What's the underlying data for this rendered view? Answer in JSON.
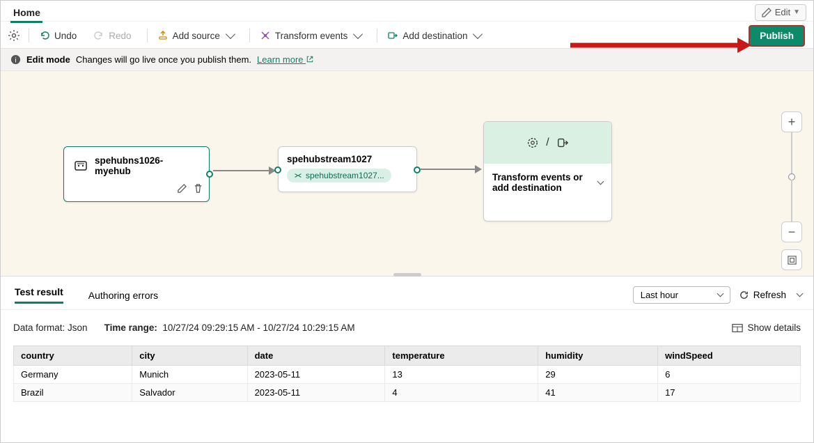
{
  "header": {
    "tab": "Home",
    "edit_label": "Edit"
  },
  "toolbar": {
    "undo": "Undo",
    "redo": "Redo",
    "add_source": "Add source",
    "transform": "Transform events",
    "add_dest": "Add destination",
    "publish": "Publish"
  },
  "info": {
    "title": "Edit mode",
    "text": "Changes will go live once you publish them.",
    "link": "Learn more"
  },
  "nodes": {
    "source": {
      "label": "spehubns1026-myehub"
    },
    "stream": {
      "title": "spehubstream1027",
      "tag": "spehubstream1027..."
    },
    "action": {
      "label": "Transform events or add destination"
    }
  },
  "bottom": {
    "tab_result": "Test result",
    "tab_errors": "Authoring errors",
    "time_options": {
      "selected": "Last hour"
    },
    "refresh": "Refresh",
    "format_label": "Data format:",
    "format_value": "Json",
    "timerange_label": "Time range:",
    "timerange_value": "10/27/24 09:29:15 AM - 10/27/24 10:29:15 AM",
    "show_details": "Show details",
    "columns": [
      "country",
      "city",
      "date",
      "temperature",
      "humidity",
      "windSpeed"
    ],
    "rows": [
      {
        "country": "Germany",
        "city": "Munich",
        "date": "2023-05-11",
        "temperature": "13",
        "humidity": "29",
        "windSpeed": "6"
      },
      {
        "country": "Brazil",
        "city": "Salvador",
        "date": "2023-05-11",
        "temperature": "4",
        "humidity": "41",
        "windSpeed": "17"
      }
    ]
  }
}
